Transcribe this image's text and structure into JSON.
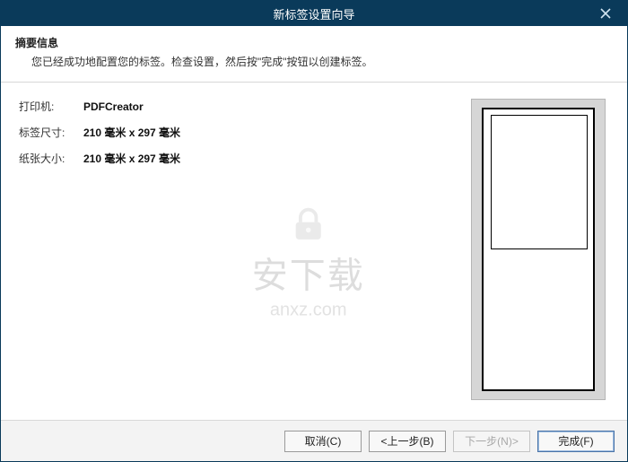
{
  "window": {
    "title": "新标签设置向导"
  },
  "header": {
    "title": "摘要信息",
    "subtitle": "您已经成功地配置您的标签。检查设置，然后按\"完成\"按钮以创建标签。"
  },
  "summary": {
    "printer_label": "打印机:",
    "printer_value": "PDFCreator",
    "label_size_label": "标签尺寸:",
    "label_size_value": "210 毫米 x 297 毫米",
    "paper_size_label": "纸张大小:",
    "paper_size_value": "210 毫米 x 297 毫米"
  },
  "buttons": {
    "cancel": "取消(C)",
    "back": "<上一步(B)",
    "next": "下一步(N)>",
    "finish": "完成(F)"
  },
  "watermark": {
    "big": "安下载",
    "small": "anxz.com"
  }
}
